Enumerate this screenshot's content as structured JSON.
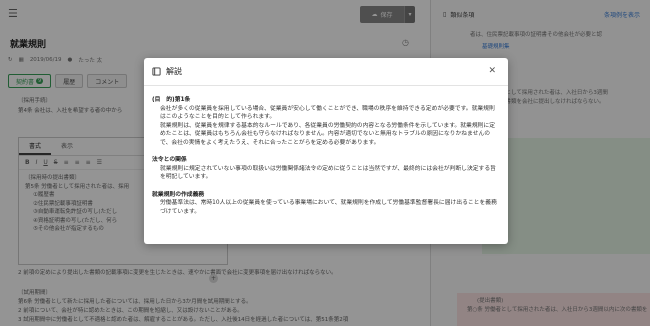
{
  "header": {
    "save_label": "保存",
    "doc_title": "就業規則",
    "meta_date": "2019/06/19",
    "meta_author": "たった 太"
  },
  "tabs": [
    {
      "label": "契約書",
      "badge": "9"
    },
    {
      "label": "履歴"
    },
    {
      "label": "コメント"
    }
  ],
  "doc": {
    "line1": "〔採用手続〕",
    "line2": "第4条  会社は、入社を希望する者の中から",
    "line3": "〔採用時の提出書類〕",
    "line4": "第5条  労働者として採用された者は、採用",
    "line5": "①履歴書",
    "line6": "②住民票記載事項証明書",
    "line7": "③自動車運転免許証の写し(ただし",
    "line8": "④資格証明書の写し(ただし、何ら",
    "line9": "⑤その他会社が指定するもの",
    "line10": "2 前項の定めにより提出した書類の記載事項に変更を生じたときは、速やかに書面で会社に変更事項を届け出なければならない。",
    "line11": "〔試用期間〕",
    "line12": "第6条  労働者として新たに採用した者については、採用した日から3か月間を試用期間とする。",
    "line13": "2 前項について、会社が特に認めたときは、この期間を短縮し、又は設けないことがある。",
    "line14": "3 試用期間中に労働者として不適格と認めた者は、解雇することがある。ただし、入社後14日を経過した者については、第51条第2項"
  },
  "editor": {
    "tab_format": "書式",
    "tab_view": "表示"
  },
  "right_panel": {
    "title": "類似条項",
    "link": "条項例を表示",
    "text1": "者は、住民票記載事項の証明書その他会社が必要と認",
    "text2": "基礎規則集",
    "text3": "用として採用された者は、入社日から3週間",
    "text4": "の書類を会社に提出しなければならない。",
    "text5": "(提出書類)",
    "text6": "第○条  労働者として採用された者は、入社日から3週間以内に次の書類を提出しなければならない。"
  },
  "modal": {
    "title": "解説",
    "sections": [
      {
        "heading": "(目　的)第1条",
        "lines": [
          "会社が多くの従業員を採用している場合、従業員が安心して働くことができ、職場の秩序を維持できる定めが必要です。就業規則はこのようなことを目的として作られます。",
          "就業規則は、従業員を規律する基本的なルールであり、各従業員の労働契約の内容となる労働条件を示しています。就業規則に定めたことは、従業員はもちろん会社も守らなければなりません。内容が適切でないと無用なトラブルの原因になりかねませんので、会社の実情をよく考えたうえ、それに合ったことがらを定める必要があります。"
        ]
      },
      {
        "heading": "法令との関係",
        "lines": [
          "就業規則に規定されていない事項の取扱いは労働関係諸法令の定めに従うことは当然ですが、最終的には会社が判断し決定する旨を明記しています。"
        ]
      },
      {
        "heading": "就業規則の作成義務",
        "lines": [
          "労働基準法は、常時10人以上の従業員を使っている事業場において、就業規則を作成して労働基準監督署長に届け出ることを義務づけています。"
        ]
      }
    ]
  },
  "colors": {
    "accent_green": "#3aa15a",
    "link_blue": "#3b7fd9",
    "overlay": "rgba(0,0,0,0.42)"
  }
}
